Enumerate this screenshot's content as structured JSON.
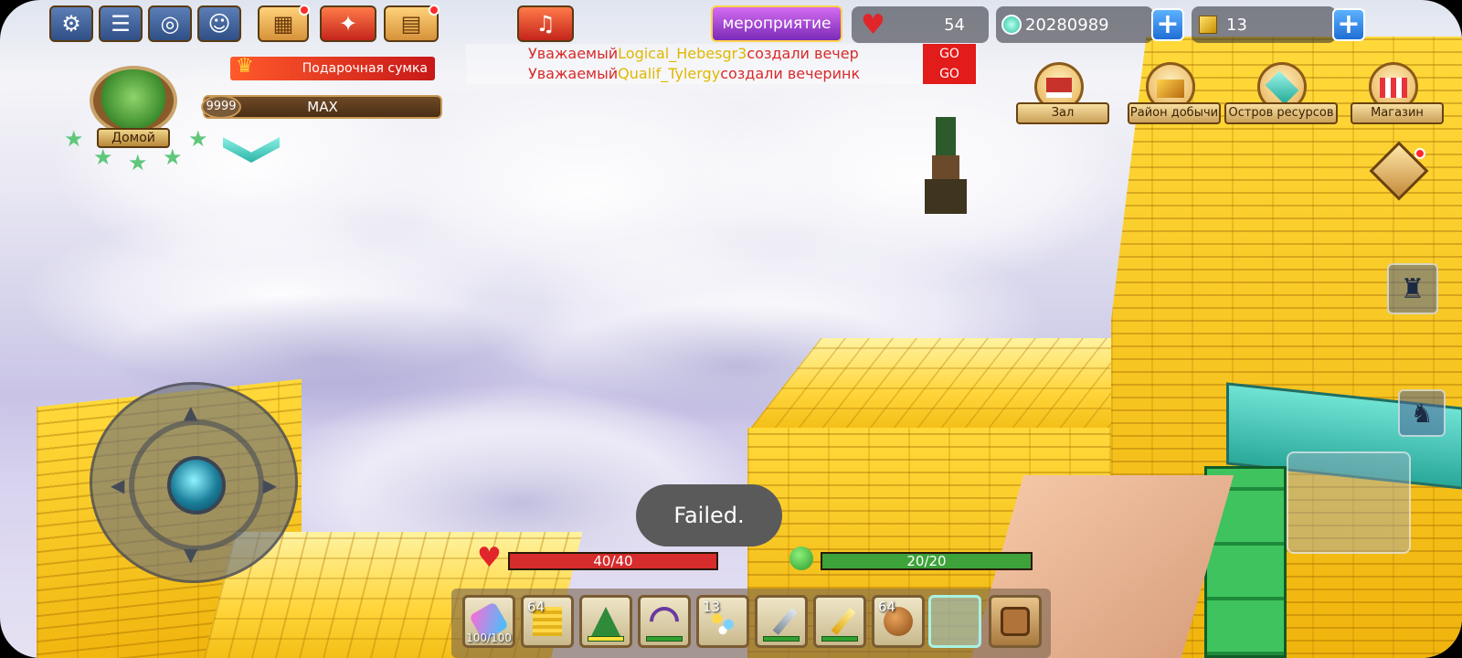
{
  "topbar": {
    "settings_icon": "gear-icon",
    "chat_icon": "chat-icon",
    "target_icon": "crosshair-icon",
    "friend_icon": "profile-icon",
    "event_label": "мероприятие",
    "hearts_value": "54",
    "diamonds_value": "20280989",
    "gold_blocks_value": "13"
  },
  "player": {
    "home_label": "Домой",
    "level_value": "9999",
    "level_label": "MAX",
    "gift_bag_label": "Подарочная сумка"
  },
  "chat": {
    "lines": [
      {
        "prefix": "Уважаемый",
        "name": "Logical_Hebesgr3",
        "text": "создали вечер",
        "go": "GO"
      },
      {
        "prefix": "Уважаемый",
        "name": "Qualif_Tylergy",
        "text": "создали вечеринк",
        "go": "GO"
      }
    ]
  },
  "nav": {
    "hall": "Зал",
    "mining": "Район добычи",
    "island": "Остров ресурсов",
    "shop": "Магазин"
  },
  "status": {
    "health_text": "40/40",
    "health_fraction": 1.0,
    "hunger_text": "20/20",
    "hunger_fraction": 1.0
  },
  "toast": {
    "text": "Failed."
  },
  "hotbar": {
    "slots": [
      {
        "count": "",
        "durability": "100/100",
        "item": "fish-gun-icon"
      },
      {
        "count": "64",
        "durability": "",
        "item": "hay-block-icon"
      },
      {
        "count": "",
        "durability": "",
        "item": "christmas-tree-icon"
      },
      {
        "count": "",
        "durability": "",
        "item": "bow-icon"
      },
      {
        "count": "13",
        "durability": "",
        "item": "flowers-icon"
      },
      {
        "count": "",
        "durability": "",
        "item": "sword-icon"
      },
      {
        "count": "",
        "durability": "",
        "item": "golden-sword-icon"
      },
      {
        "count": "64",
        "durability": "",
        "item": "bread-icon"
      },
      {
        "count": "",
        "durability": "",
        "item": "empty-slot"
      }
    ]
  },
  "colors": {
    "health": "#d62c2c",
    "hunger": "#3da23a",
    "gold": "#f7c21a",
    "toast_bg": "#5a5a5a"
  }
}
